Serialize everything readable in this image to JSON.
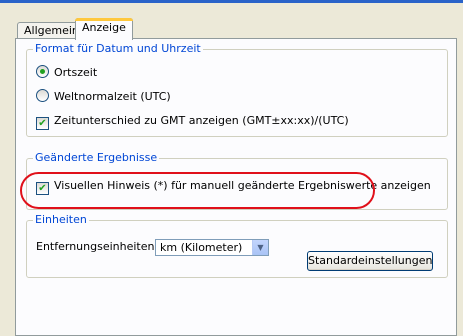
{
  "tabs": [
    {
      "label": "Allgemein",
      "active": false
    },
    {
      "label": "Anzeige",
      "active": true
    }
  ],
  "datetime_group": {
    "title": "Format für Datum und Uhrzeit",
    "options": [
      {
        "label": "Ortszeit",
        "selected": true
      },
      {
        "label": "Weltnormalzeit (UTC)",
        "selected": false
      }
    ],
    "gmt_checkbox": {
      "label": "Zeitunterschied zu GMT anzeigen (GMT±xx:xx)/(UTC)",
      "checked": true,
      "mark": "✔"
    }
  },
  "results_group": {
    "title": "Geänderte Ergebnisse",
    "checkbox": {
      "label": "Visuellen Hinweis (*) für manuell geänderte Ergebniswerte anzeigen",
      "checked": true,
      "mark": "✔"
    }
  },
  "units_group": {
    "title": "Einheiten",
    "distance_label": "Entfernungseinheiten:",
    "distance_value": "km (Kilometer)",
    "defaults_button": "Standardeinstellungen"
  },
  "colors": {
    "accent": "#0046d5",
    "highlight": "#e0101a",
    "check": "#21a121"
  }
}
